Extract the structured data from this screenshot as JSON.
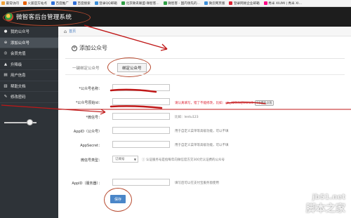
{
  "browser": {
    "bookmarks": [
      {
        "label": "最常访问",
        "color": "#f1a33a"
      },
      {
        "label": "火狐官方站点",
        "color": "#e66000"
      },
      {
        "label": "百度推广",
        "color": "#2f6fd8"
      },
      {
        "label": "百度搜索",
        "color": "#2f6fd8"
      },
      {
        "label": "登录QQ邮箱",
        "color": "#3b8ed8"
      },
      {
        "label": "北京微讯联盟-微智客...",
        "color": "#2f9e44"
      },
      {
        "label": "微智客 - 国内领先的...",
        "color": "#2f9e44"
      },
      {
        "label": "微云网页版",
        "color": "#3b8ed8"
      },
      {
        "label": "登录网易企业邮箱",
        "color": "#d23"
      },
      {
        "label": "秀米 XIUMI | 秀米 XI...",
        "color": "#f08"
      }
    ]
  },
  "app": {
    "title": "微智客后台管理系统"
  },
  "sidebar": {
    "items": [
      {
        "label": "我的公众号",
        "icon": "user-icon",
        "glyph": "●",
        "active": false
      },
      {
        "label": "添加公众号",
        "icon": "plus-circle-icon",
        "glyph": "⊕",
        "active": true
      },
      {
        "label": "会员充值",
        "icon": "coin-icon",
        "glyph": "◎",
        "active": false
      },
      {
        "label": "升降级",
        "icon": "up-arrow-icon",
        "glyph": "▲",
        "active": false
      },
      {
        "label": "用户信息",
        "icon": "doc-icon",
        "glyph": "▤",
        "active": false
      },
      {
        "label": "帮助文档",
        "icon": "book-icon",
        "glyph": "▥",
        "active": false
      },
      {
        "label": "修改密码",
        "icon": "key-icon",
        "glyph": "✎",
        "active": false
      }
    ]
  },
  "breadcrumb": {
    "home": "首页"
  },
  "page": {
    "title": "添加公众号",
    "tab_quick": "一键绑定公众号",
    "tab_bind": "绑定公众号"
  },
  "form": {
    "name_label": "*公众号名称：",
    "origin_id_label": "*公众号原始id：",
    "origin_id_hint": "请认真填写，错了不能修改，比如：gh_423dwjkeww3",
    "origin_id_help": "?不懂找点我",
    "wechat_label": "*微信号：",
    "wechat_hint": "比如：lentu123",
    "appid_label": "AppID（公众号）",
    "appid_hint": "用于自定义菜单等高级功能，可以不填",
    "appsecret_label": "AppSecret：",
    "appsecret_hint": "用于自定义菜单等高级功能，可以不填",
    "type_label": "微信号类型：",
    "type_value": "订阅号",
    "type_hint": "认证服务号是指每年向微信官方交300元认证费的公众号",
    "pay_appid_label": "AppID（服务器）：",
    "pay_appid_hint": "填写后可以在支付宝服务窗使用",
    "save_label": "保存"
  },
  "watermark": {
    "site": "jb51.net",
    "name": "脚本之家"
  },
  "colors": {
    "annotation": "#b74a2f",
    "underline": "#c01818",
    "accent": "#4a86c8"
  }
}
